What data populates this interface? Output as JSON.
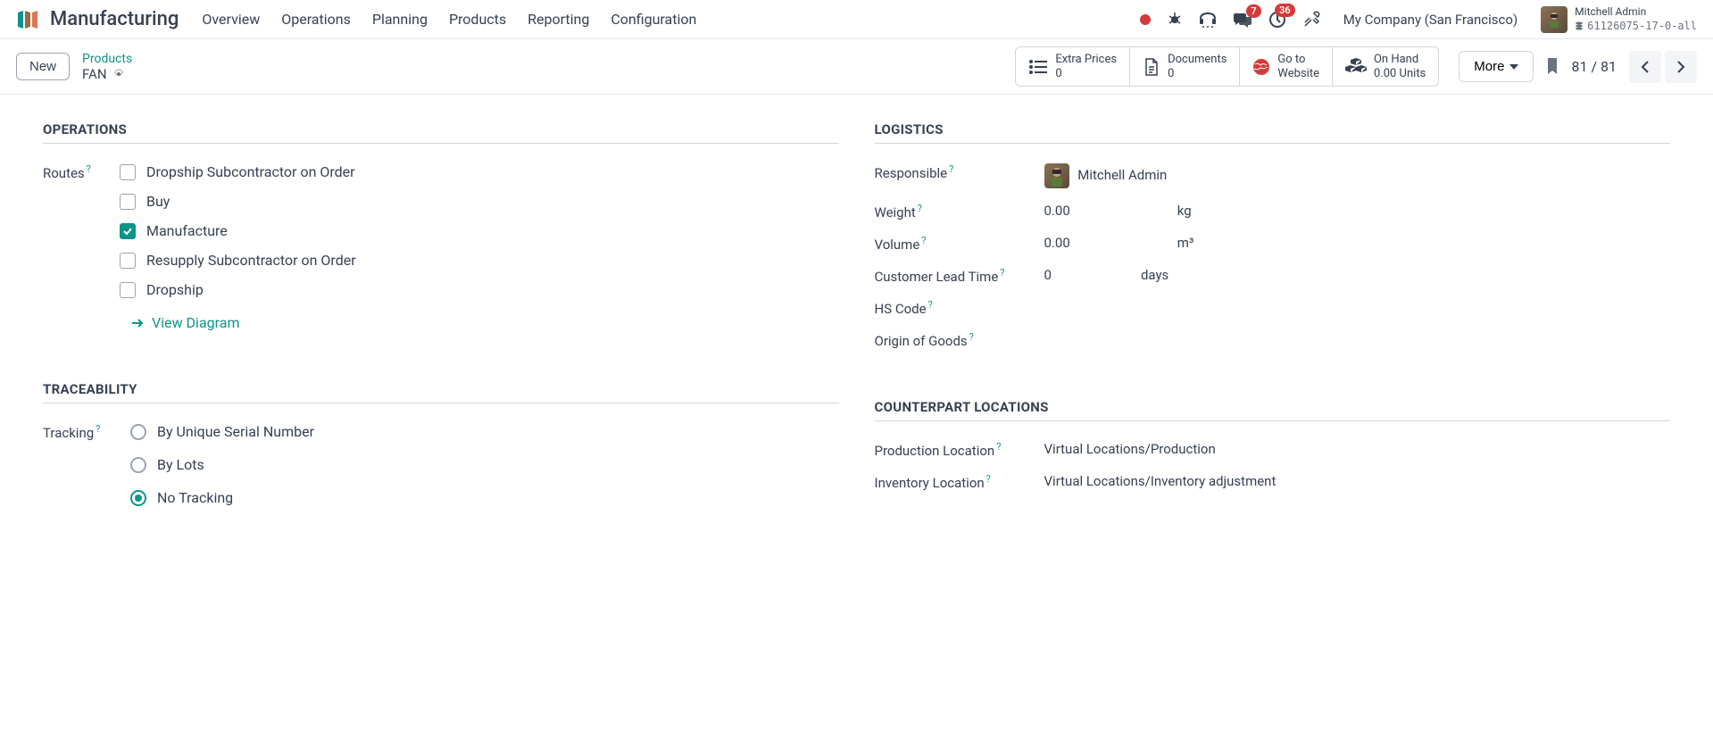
{
  "header": {
    "app_title": "Manufacturing",
    "nav": [
      "Overview",
      "Operations",
      "Planning",
      "Products",
      "Reporting",
      "Configuration"
    ],
    "company": "My Company (San Francisco)",
    "badges": {
      "chat": "7",
      "activity": "36"
    },
    "user": {
      "name": "Mitchell Admin",
      "db": "61126075-17-0-all"
    }
  },
  "subheader": {
    "new_label": "New",
    "breadcrumb_parent": "Products",
    "breadcrumb_current": "FAN",
    "stats": {
      "extra_prices": {
        "label": "Extra Prices",
        "value": "0"
      },
      "documents": {
        "label": "Documents",
        "value": "0"
      },
      "website": {
        "label1": "Go to",
        "label2": "Website"
      },
      "on_hand": {
        "label": "On Hand",
        "value": "0.00 Units"
      }
    },
    "more_label": "More",
    "pager": "81 / 81"
  },
  "operations": {
    "title": "OPERATIONS",
    "routes_label": "Routes",
    "routes": [
      {
        "label": "Dropship Subcontractor on Order",
        "checked": false
      },
      {
        "label": "Buy",
        "checked": false
      },
      {
        "label": "Manufacture",
        "checked": true
      },
      {
        "label": "Resupply Subcontractor on Order",
        "checked": false
      },
      {
        "label": "Dropship",
        "checked": false
      }
    ],
    "view_diagram": "View Diagram"
  },
  "traceability": {
    "title": "TRACEABILITY",
    "tracking_label": "Tracking",
    "options": [
      {
        "label": "By Unique Serial Number",
        "checked": false
      },
      {
        "label": "By Lots",
        "checked": false
      },
      {
        "label": "No Tracking",
        "checked": true
      }
    ]
  },
  "logistics": {
    "title": "LOGISTICS",
    "responsible_label": "Responsible",
    "responsible_value": "Mitchell Admin",
    "weight_label": "Weight",
    "weight_value": "0.00",
    "weight_unit": "kg",
    "volume_label": "Volume",
    "volume_value": "0.00",
    "volume_unit": "m³",
    "lead_label": "Customer Lead Time",
    "lead_value": "0",
    "lead_unit": "days",
    "hs_label": "HS Code",
    "origin_label": "Origin of Goods"
  },
  "counterpart": {
    "title": "COUNTERPART LOCATIONS",
    "prod_label": "Production Location",
    "prod_value": "Virtual Locations/Production",
    "inv_label": "Inventory Location",
    "inv_value": "Virtual Locations/Inventory adjustment"
  }
}
